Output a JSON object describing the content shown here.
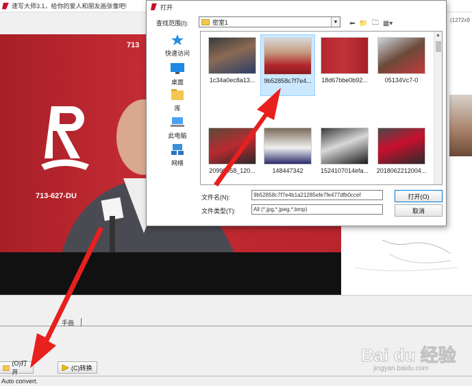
{
  "app": {
    "title": "速写大师3.1，给你的爱人和朋友画张像吧!",
    "size_readout": "(1272x9",
    "status": "Auto convert.",
    "tab_label": "手画",
    "buttons": {
      "open": "(O)打开",
      "convert": "(C)转换"
    }
  },
  "photo": {
    "phone_left": "713-627-DU",
    "phone_top": "713"
  },
  "dialog": {
    "title": "打开",
    "look_in_label": "查找范围(I):",
    "look_in_value": "密室1",
    "places": [
      {
        "label": "快速访问",
        "icon": "star-icon"
      },
      {
        "label": "桌面",
        "icon": "desktop-icon"
      },
      {
        "label": "库",
        "icon": "library-icon"
      },
      {
        "label": "此电脑",
        "icon": "computer-icon"
      },
      {
        "label": "网络",
        "icon": "network-icon"
      }
    ],
    "files": [
      {
        "name": "1c34a0ec8a13...",
        "selected": false
      },
      {
        "name": "9b52858c7f7e4...",
        "selected": true
      },
      {
        "name": "18d67bbe0b92...",
        "selected": false
      },
      {
        "name": "05134Vc7-0",
        "selected": false
      },
      {
        "name": "20990058_120...",
        "selected": false
      },
      {
        "name": "148447342",
        "selected": false
      },
      {
        "name": "1524107014efa...",
        "selected": false
      },
      {
        "name": "2018062212004...",
        "selected": false
      }
    ],
    "file_name_label": "文件名(N):",
    "file_name_value": "9b52858c7f7e4b1a21285efe7fe477dfb0ccef",
    "file_type_label": "文件类型(T):",
    "file_type_value": "All (*.jpg,*.jpeg,*.bmp)",
    "ok_label": "打开(O)",
    "cancel_label": "取消"
  },
  "watermark": {
    "text": "Bai du 经验",
    "sub": "jingyan.baidu.com"
  },
  "colors": {
    "accent": "#0078d7",
    "arrow": "#e8201e",
    "rockets_red": "#c32b33"
  }
}
